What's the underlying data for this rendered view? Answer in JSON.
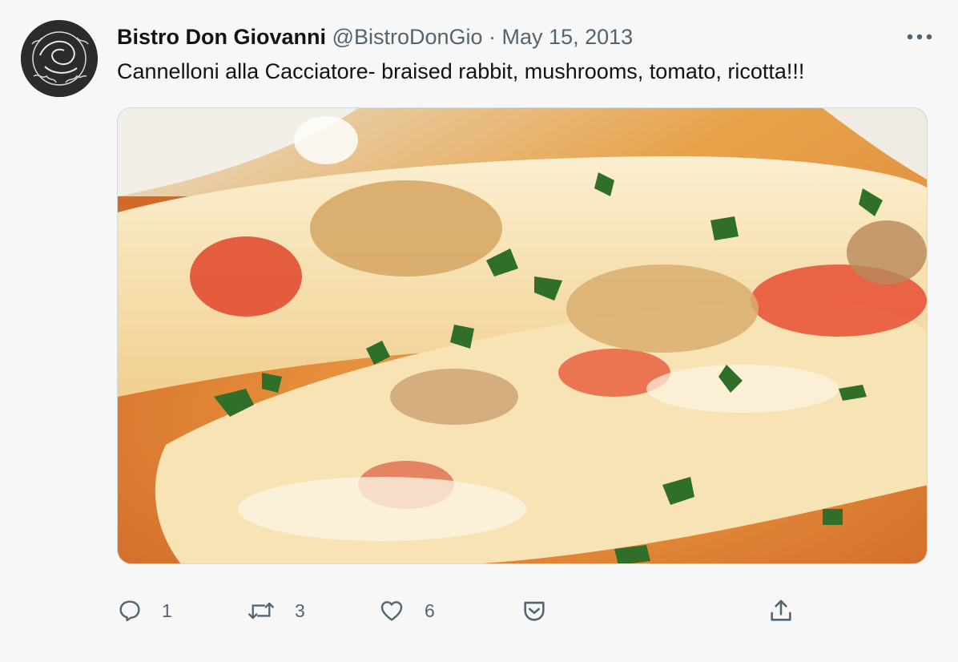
{
  "tweet": {
    "author_name": "Bistro Don Giovanni",
    "author_handle": "@BistroDonGio",
    "separator": "·",
    "date": "May 15, 2013",
    "text": "Cannelloni alla Cacciatore- braised rabbit, mushrooms, tomato, ricotta!!!",
    "more_icon": "more-horizontal-icon",
    "media_description_icon": "photo"
  },
  "actions": {
    "reply": {
      "icon": "reply-icon",
      "count": "1"
    },
    "retweet": {
      "icon": "retweet-icon",
      "count": "3"
    },
    "like": {
      "icon": "heart-icon",
      "count": "6"
    },
    "save": {
      "icon": "bookmark-pocket-icon"
    },
    "share": {
      "icon": "share-icon"
    }
  },
  "colors": {
    "background": "#f7f7f7",
    "text_primary": "#0f1419",
    "text_secondary": "#536471",
    "border": "#cfd9de"
  }
}
